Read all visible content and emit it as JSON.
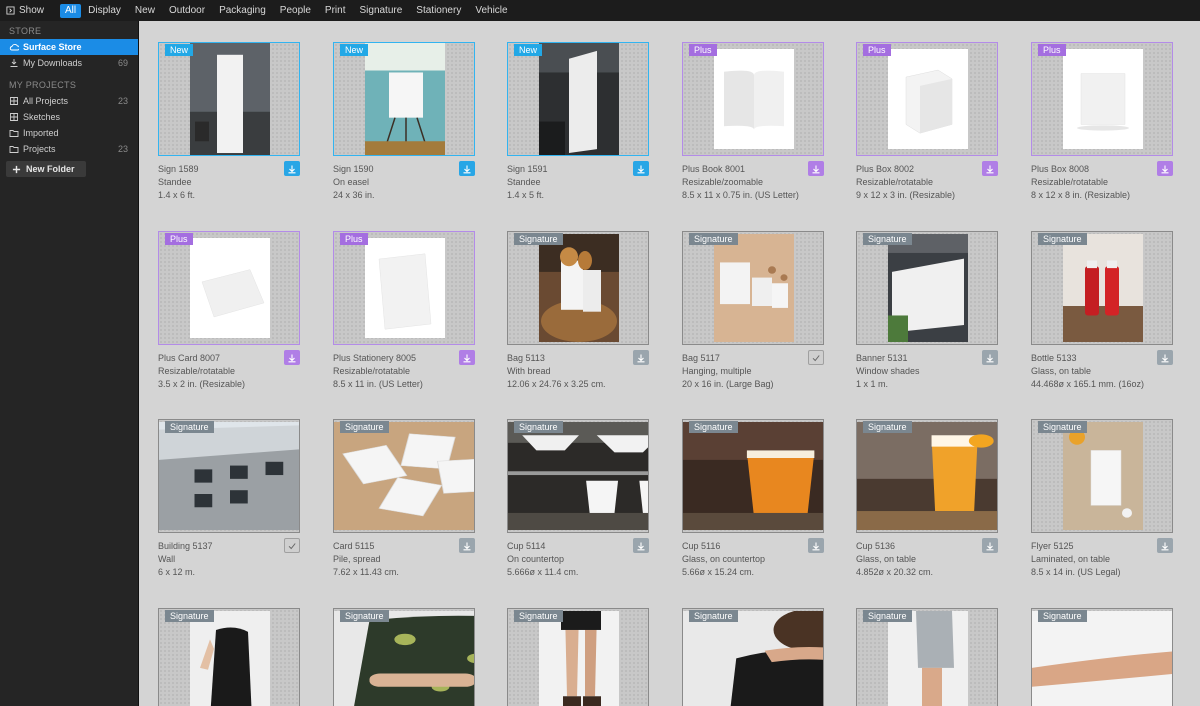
{
  "topbar": {
    "show_label": "Show",
    "filters": [
      "All",
      "Display",
      "New",
      "Outdoor",
      "Packaging",
      "People",
      "Print",
      "Signature",
      "Stationery",
      "Vehicle"
    ],
    "active_filter": "All"
  },
  "sidebar": {
    "store_header": "STORE",
    "store_items": [
      {
        "label": "Surface Store",
        "count": "",
        "icon": "cloud-icon",
        "active": true
      },
      {
        "label": "My Downloads",
        "count": "69",
        "icon": "download-icon",
        "active": false
      }
    ],
    "projects_header": "MY PROJECTS",
    "project_items": [
      {
        "label": "All Projects",
        "count": "23",
        "icon": "grid-icon"
      },
      {
        "label": "Sketches",
        "count": "",
        "icon": "grid-icon"
      },
      {
        "label": "Imported",
        "count": "",
        "icon": "folder-icon"
      },
      {
        "label": "Projects",
        "count": "23",
        "icon": "folder-icon"
      }
    ],
    "new_folder_label": "New Folder"
  },
  "colors": {
    "accent": "#1b8ce6",
    "new_badge": "#22a8e6",
    "plus_badge": "#a46ee0",
    "signature_badge": "#7b8790"
  },
  "cards": [
    {
      "badge": "New",
      "kind": "new",
      "title": "Sign 1589",
      "line2": "Standee",
      "line3": "1.4 x 6 ft.",
      "action": "download",
      "photo": "standee"
    },
    {
      "badge": "New",
      "kind": "new",
      "title": "Sign 1590",
      "line2": "On easel",
      "line3": "24 x 36 in.",
      "action": "download",
      "photo": "easel"
    },
    {
      "badge": "New",
      "kind": "new",
      "title": "Sign 1591",
      "line2": "Standee",
      "line3": "1.4 x 5 ft.",
      "action": "download",
      "photo": "standee2"
    },
    {
      "badge": "Plus",
      "kind": "plus",
      "title": "Plus Book 8001",
      "line2": "Resizable/zoomable",
      "line3": "8.5 x 11 x 0.75 in. (US Letter)",
      "action": "download",
      "photo": "book"
    },
    {
      "badge": "Plus",
      "kind": "plus",
      "title": "Plus Box 8002",
      "line2": "Resizable/rotatable",
      "line3": "9 x 12 x 3 in. (Resizable)",
      "action": "download",
      "photo": "box"
    },
    {
      "badge": "Plus",
      "kind": "plus",
      "title": "Plus Box 8008",
      "line2": "Resizable/rotatable",
      "line3": "8 x 12 x 8 in. (Resizable)",
      "action": "download",
      "photo": "box2"
    },
    {
      "badge": "Plus",
      "kind": "plus",
      "title": "Plus Card 8007",
      "line2": "Resizable/rotatable",
      "line3": "3.5 x 2 in. (Resizable)",
      "action": "download",
      "photo": "card"
    },
    {
      "badge": "Plus",
      "kind": "plus",
      "title": "Plus Stationery 8005",
      "line2": "Resizable/rotatable",
      "line3": "8.5 x 11 in. (US Letter)",
      "action": "download",
      "photo": "sheet"
    },
    {
      "badge": "Signature",
      "kind": "sig",
      "title": "Bag 5113",
      "line2": "With bread",
      "line3": "12.06 x 24.76 x 3.25 cm.",
      "action": "download",
      "photo": "bread"
    },
    {
      "badge": "Signature",
      "kind": "sig",
      "title": "Bag 5117",
      "line2": "Hanging, multiple",
      "line3": "20 x 16 in. (Large Bag)",
      "action": "check",
      "photo": "bags"
    },
    {
      "badge": "Signature",
      "kind": "sig",
      "title": "Banner 5131",
      "line2": "Window shades",
      "line3": "1 x 1 m.",
      "action": "download",
      "photo": "banner"
    },
    {
      "badge": "Signature",
      "kind": "sig",
      "title": "Bottle 5133",
      "line2": "Glass, on table",
      "line3": "44.468ø x 165.1 mm. (16oz)",
      "action": "download",
      "photo": "bottles"
    },
    {
      "badge": "Signature",
      "kind": "sig",
      "title": "Building 5137",
      "line2": "Wall",
      "line3": "6 x 12 m.",
      "action": "check",
      "photo": "building"
    },
    {
      "badge": "Signature",
      "kind": "sig",
      "title": "Card 5115",
      "line2": "Pile, spread",
      "line3": "7.62 x 11.43 cm.",
      "action": "download",
      "photo": "cards"
    },
    {
      "badge": "Signature",
      "kind": "sig",
      "title": "Cup 5114",
      "line2": "On countertop",
      "line3": "5.666ø x 11.4 cm.",
      "action": "download",
      "photo": "cups"
    },
    {
      "badge": "Signature",
      "kind": "sig",
      "title": "Cup 5116",
      "line2": "Glass, on countertop",
      "line3": "5.66ø x 15.24 cm.",
      "action": "download",
      "photo": "beer"
    },
    {
      "badge": "Signature",
      "kind": "sig",
      "title": "Cup 5136",
      "line2": "Glass, on table",
      "line3": "4.852ø x 20.32 cm.",
      "action": "download",
      "photo": "beer2"
    },
    {
      "badge": "Signature",
      "kind": "sig",
      "title": "Flyer 5125",
      "line2": "Laminated, on table",
      "line3": "8.5 x 14 in. (US Legal)",
      "action": "download",
      "photo": "flyer"
    },
    {
      "badge": "Signature",
      "kind": "sig",
      "title": "",
      "line2": "",
      "line3": "",
      "action": "",
      "photo": "shirt1"
    },
    {
      "badge": "Signature",
      "kind": "sig",
      "title": "",
      "line2": "",
      "line3": "",
      "action": "",
      "photo": "shirt2"
    },
    {
      "badge": "Signature",
      "kind": "sig",
      "title": "",
      "line2": "",
      "line3": "",
      "action": "",
      "photo": "legs"
    },
    {
      "badge": "Signature",
      "kind": "sig",
      "title": "",
      "line2": "",
      "line3": "",
      "action": "",
      "photo": "back"
    },
    {
      "badge": "Signature",
      "kind": "sig",
      "title": "",
      "line2": "",
      "line3": "",
      "action": "",
      "photo": "arm"
    },
    {
      "badge": "Signature",
      "kind": "sig",
      "title": "",
      "line2": "",
      "line3": "",
      "action": "",
      "photo": "hand"
    }
  ]
}
